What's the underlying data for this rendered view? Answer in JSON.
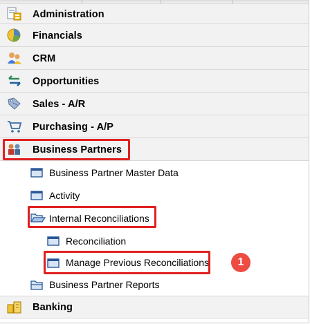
{
  "menu": {
    "modules": [
      {
        "label": "Administration",
        "icon": "administration-icon"
      },
      {
        "label": "Financials",
        "icon": "financials-icon"
      },
      {
        "label": "CRM",
        "icon": "crm-icon"
      },
      {
        "label": "Opportunities",
        "icon": "opportunities-icon"
      },
      {
        "label": "Sales - A/R",
        "icon": "sales-icon"
      },
      {
        "label": "Purchasing - A/P",
        "icon": "purchasing-cart-icon"
      },
      {
        "label": "Business Partners",
        "icon": "business-partners-icon"
      },
      {
        "label": "Banking",
        "icon": "banking-icon"
      }
    ],
    "business_partners_items": [
      {
        "label": "Business Partner Master Data",
        "icon": "form-window-icon"
      },
      {
        "label": "Activity",
        "icon": "form-window-icon"
      },
      {
        "label": "Internal Reconciliations",
        "icon": "open-folder-icon"
      },
      {
        "label": "Business Partner Reports",
        "icon": "folder-icon"
      }
    ],
    "internal_reconciliations_items": [
      {
        "label": "Reconciliation",
        "icon": "form-window-icon"
      },
      {
        "label": "Manage Previous Reconciliations",
        "icon": "form-window-icon"
      }
    ]
  },
  "annotation": {
    "step_badge": "1",
    "highlight_color": "#e02020",
    "badge_color": "#ee4b42"
  }
}
